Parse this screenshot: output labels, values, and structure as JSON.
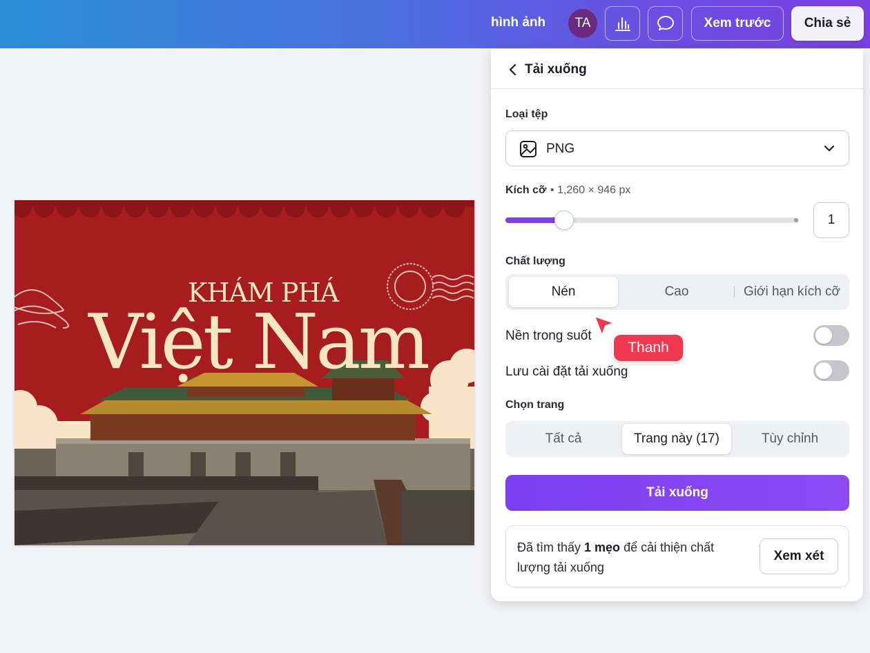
{
  "topbar": {
    "project_text": "hình ảnh",
    "avatar_initials": "TA",
    "preview_label": "Xem trước",
    "share_label": "Chia sẻ"
  },
  "design": {
    "title_small": "KHÁM PHÁ",
    "title_big": "Việt Nam"
  },
  "panel": {
    "title": "Tải xuống",
    "file_type_label": "Loại tệp",
    "file_type_value": "PNG",
    "size_label": "Kích cỡ",
    "size_value": "• 1,260 × 946 px",
    "scale_value": "1",
    "scale_fraction": 0.2,
    "quality_label": "Chất lượng",
    "quality_options": [
      "Nén",
      "Cao",
      "Giới hạn kích cỡ"
    ],
    "quality_selected": "Nén",
    "transparent_label": "Nền trong suốt",
    "save_settings_label": "Lưu cài đặt tải xuống",
    "page_label": "Chọn trang",
    "page_options": [
      "Tất cả",
      "Trang này (17)",
      "Tùy chỉnh"
    ],
    "page_selected": "Trang này (17)",
    "download_button": "Tải xuống",
    "tip_prefix": "Đã tìm thấy ",
    "tip_bold": "1 mẹo",
    "tip_suffix": " để cải thiện chất lượng tải xuống",
    "review_button": "Xem xét"
  },
  "collaborator": {
    "name": "Thanh",
    "color": "#f0384e"
  },
  "colors": {
    "accent": "#7b3ff2",
    "design_red": "#a61c1f",
    "design_cream": "#f7e6c4"
  }
}
